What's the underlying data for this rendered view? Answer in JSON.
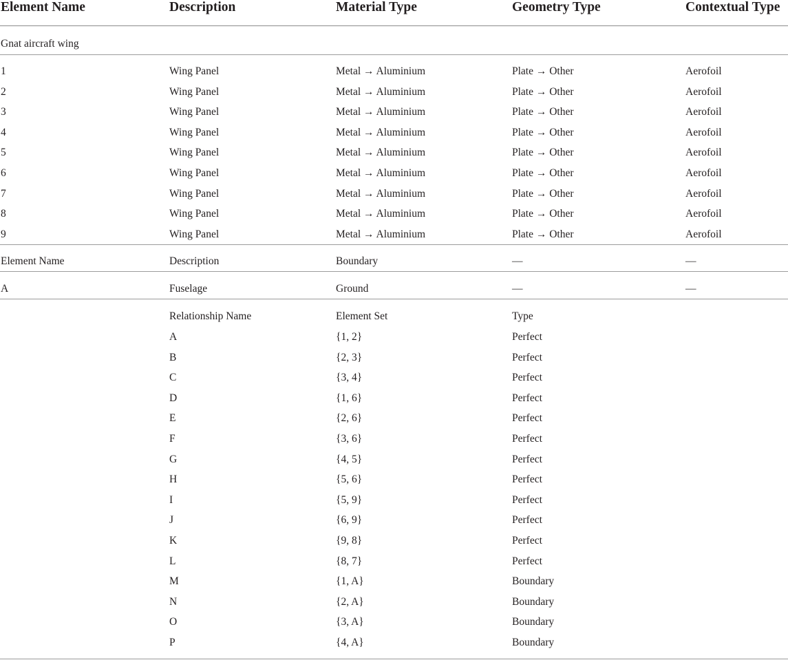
{
  "table": {
    "header": [
      "Element Name",
      "Description",
      "Material Type",
      "Geometry Type",
      "Contextual Type"
    ],
    "section_label": "Gnat aircraft wing",
    "element_rows": [
      [
        "1",
        "Wing Panel",
        "Metal → Aluminium",
        "Plate → Other",
        "Aerofoil"
      ],
      [
        "2",
        "Wing Panel",
        "Metal → Aluminium",
        "Plate → Other",
        "Aerofoil"
      ],
      [
        "3",
        "Wing Panel",
        "Metal → Aluminium",
        "Plate → Other",
        "Aerofoil"
      ],
      [
        "4",
        "Wing Panel",
        "Metal → Aluminium",
        "Plate → Other",
        "Aerofoil"
      ],
      [
        "5",
        "Wing Panel",
        "Metal → Aluminium",
        "Plate → Other",
        "Aerofoil"
      ],
      [
        "6",
        "Wing Panel",
        "Metal → Aluminium",
        "Plate → Other",
        "Aerofoil"
      ],
      [
        "7",
        "Wing Panel",
        "Metal → Aluminium",
        "Plate → Other",
        "Aerofoil"
      ],
      [
        "8",
        "Wing Panel",
        "Metal → Aluminium",
        "Plate → Other",
        "Aerofoil"
      ],
      [
        "9",
        "Wing Panel",
        "Metal → Aluminium",
        "Plate → Other",
        "Aerofoil"
      ]
    ],
    "boundary_header": [
      "Element Name",
      "Description",
      "Boundary",
      "—",
      "—"
    ],
    "boundary_row": [
      "A",
      "Fuselage",
      "Ground",
      "—",
      "—"
    ],
    "relationship_header": [
      "Relationship Name",
      "Element Set",
      "Type"
    ],
    "relationship_rows": [
      [
        "A",
        "{1, 2}",
        "Perfect"
      ],
      [
        "B",
        "{2, 3}",
        "Perfect"
      ],
      [
        "C",
        "{3, 4}",
        "Perfect"
      ],
      [
        "D",
        "{1, 6}",
        "Perfect"
      ],
      [
        "E",
        "{2, 6}",
        "Perfect"
      ],
      [
        "F",
        "{3, 6}",
        "Perfect"
      ],
      [
        "G",
        "{4, 5}",
        "Perfect"
      ],
      [
        "H",
        "{5, 6}",
        "Perfect"
      ],
      [
        "I",
        "{5, 9}",
        "Perfect"
      ],
      [
        "J",
        "{6, 9}",
        "Perfect"
      ],
      [
        "K",
        "{9, 8}",
        "Perfect"
      ],
      [
        "L",
        "{8, 7}",
        "Perfect"
      ],
      [
        "M",
        "{1, A}",
        "Boundary"
      ],
      [
        "N",
        "{2, A}",
        "Boundary"
      ],
      [
        "O",
        "{3, A}",
        "Boundary"
      ],
      [
        "P",
        "{4, A}",
        "Boundary"
      ]
    ]
  }
}
